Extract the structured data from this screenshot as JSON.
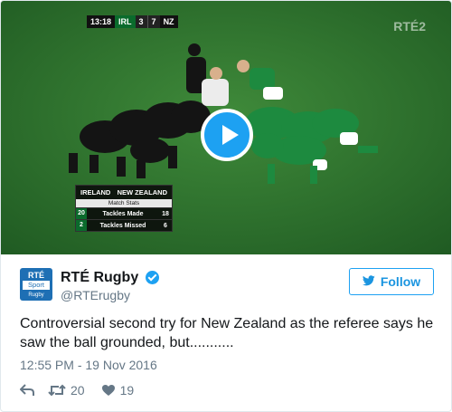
{
  "video": {
    "scorebug": {
      "time": "13:18",
      "team1": "IRL",
      "score1": "3",
      "score2": "7",
      "team2": "NZ"
    },
    "channel_logo": "RTÉ2",
    "match_stats": {
      "team1": "IRELAND",
      "team2": "NEW ZEALAND",
      "subtitle": "Match Stats",
      "rows": [
        {
          "label": "Tackles Made",
          "team1_value": "20",
          "team2_value": "18"
        },
        {
          "label": "Tackles Missed",
          "team1_value": "2",
          "team2_value": "6"
        }
      ]
    },
    "play_icon": "play-icon"
  },
  "tweet": {
    "avatar": {
      "line1": "RTÉ",
      "line2": "Sport",
      "line3": "Rugby"
    },
    "display_name": "RTÉ Rugby",
    "handle": "@RTErugby",
    "follow_label": "Follow",
    "text": "Controversial second try for New Zealand as the referee says he saw the ball grounded, but...........",
    "timestamp": "12:55 PM - 19 Nov 2016",
    "retweet_count": "20",
    "like_count": "19",
    "accent_color": "#1da1f2"
  }
}
